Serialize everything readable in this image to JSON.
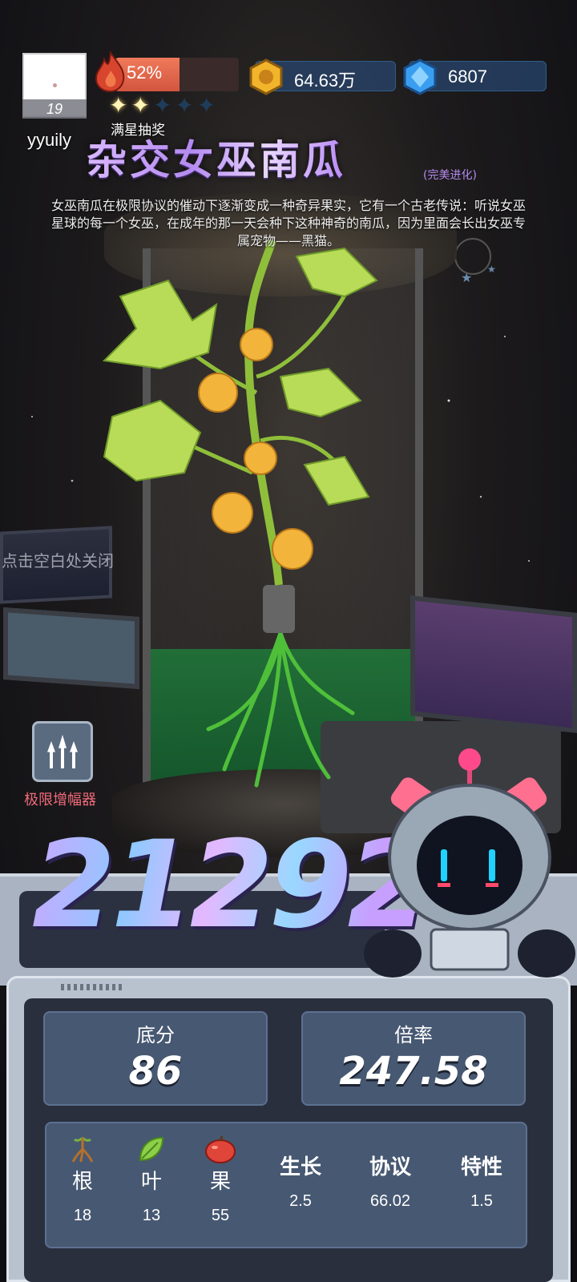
{
  "player": {
    "level": "19",
    "name": "yyuily"
  },
  "progress": {
    "percent_label": "52%",
    "fraction": 0.52,
    "stars_filled": 2,
    "stars_total": 5,
    "star_draw_label": "满星抽奖"
  },
  "currency": {
    "coins": "64.63万",
    "gems": "6807"
  },
  "item": {
    "title": "杂交女巫南瓜",
    "tag": "(完美进化)",
    "description": "女巫南瓜在极限协议的催动下逐渐变成一种奇异果实，它有一个古老传说：听说女巫星球的每一个女巫，在成年的那一天会种下这种神奇的南瓜，因为里面会长出女巫专属宠物——黑猫。"
  },
  "hints": {
    "close": "点击空白处关闭"
  },
  "amplifier": {
    "label": "极限增幅器"
  },
  "score": {
    "total": "21292"
  },
  "stats": {
    "base_label": "底分",
    "base_value": "86",
    "mult_label": "倍率",
    "mult_value": "247.58"
  },
  "attributes": [
    {
      "name": "根",
      "value": "18",
      "icon": "root-icon"
    },
    {
      "name": "叶",
      "value": "13",
      "icon": "leaf-icon"
    },
    {
      "name": "果",
      "value": "55",
      "icon": "fruit-icon"
    },
    {
      "name": "生长",
      "value": "2.5"
    },
    {
      "name": "协议",
      "value": "66.02"
    },
    {
      "name": "特性",
      "value": "1.5"
    }
  ],
  "colors": {
    "accent_purple": "#b48af0",
    "amp_label": "#f06a7a",
    "panel": "#475872"
  }
}
